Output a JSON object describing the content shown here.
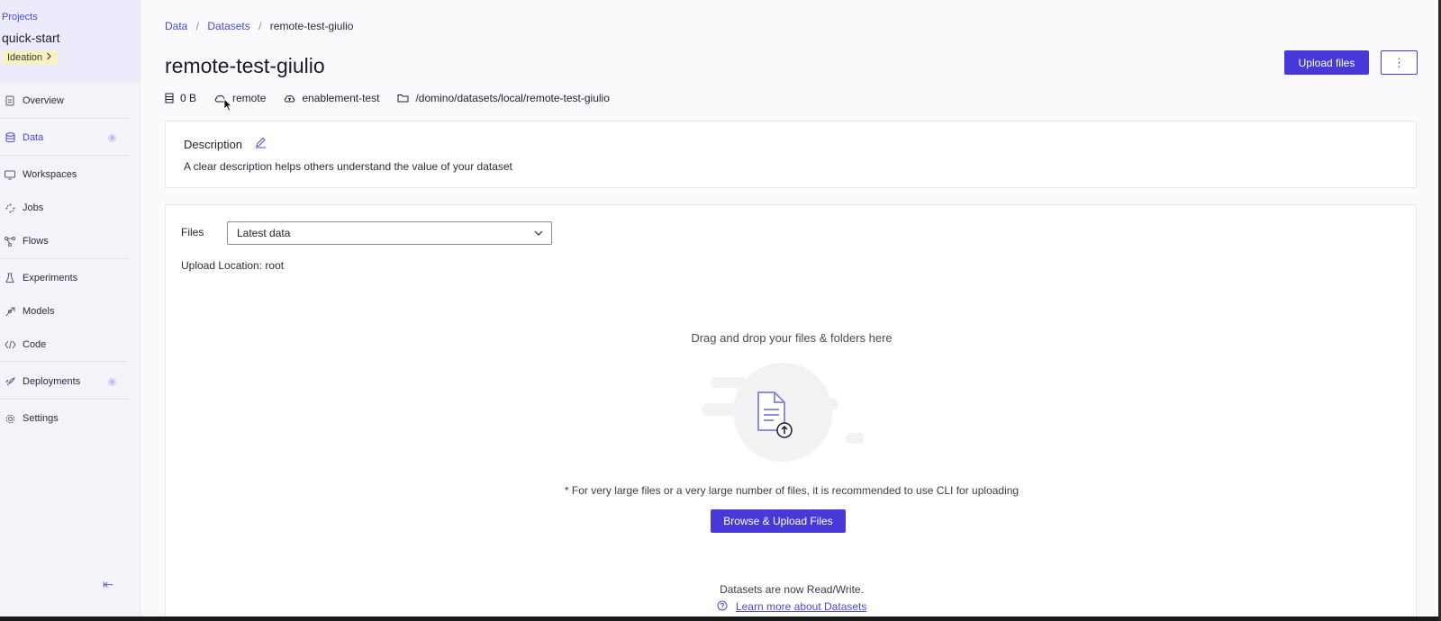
{
  "sidebar": {
    "projects_label": "Projects",
    "project_name": "quick-start",
    "stage": "Ideation",
    "items": [
      {
        "label": "Overview"
      },
      {
        "label": "Data"
      },
      {
        "label": "Workspaces"
      },
      {
        "label": "Jobs"
      },
      {
        "label": "Flows"
      },
      {
        "label": "Experiments"
      },
      {
        "label": "Models"
      },
      {
        "label": "Code"
      },
      {
        "label": "Deployments"
      },
      {
        "label": "Settings"
      }
    ],
    "collapse_glyph": "⇤"
  },
  "breadcrumb": {
    "items": [
      "Data",
      "Datasets",
      "remote-test-giulio"
    ],
    "separator": "/"
  },
  "header": {
    "title": "remote-test-giulio",
    "upload_label": "Upload files",
    "more_label": "⋮"
  },
  "meta": {
    "size": "0 B",
    "storage": "remote",
    "volume": "enablement-test",
    "path": "/domino/datasets/local/remote-test-giulio"
  },
  "description": {
    "title": "Description",
    "placeholder": "A clear description helps others understand the value of your dataset"
  },
  "files": {
    "label": "Files",
    "selected": "Latest data",
    "upload_location": "Upload Location: root",
    "dnd_text": "Drag and drop your files & folders here",
    "cli_note": "* For very large files or a very large number of files, it is recommended to use CLI for uploading",
    "browse_label": "Browse & Upload Files",
    "rw_note": "Datasets are now Read/Write.",
    "learn_more": "Learn more about Datasets"
  },
  "colors": {
    "accent": "#4838d8",
    "link": "#4b47d6",
    "stage_badge": "#faf0c6"
  }
}
